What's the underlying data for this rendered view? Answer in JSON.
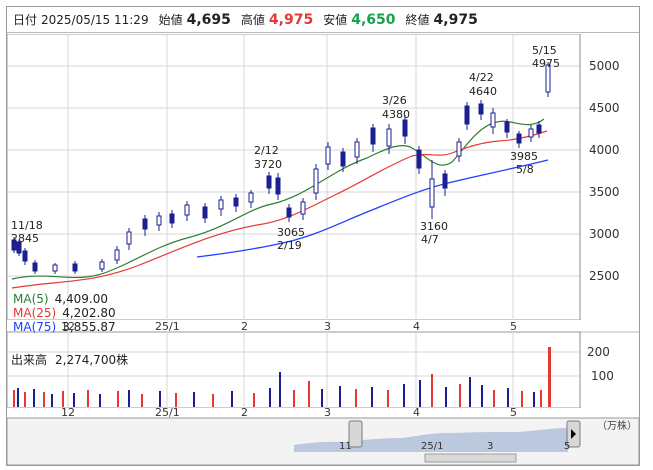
{
  "header": {
    "date_label": "日付",
    "date_value": "2025/05/15 11:29",
    "open_label": "始値",
    "open_value": "4,695",
    "high_label": "高値",
    "high_value": "4,975",
    "low_label": "安値",
    "low_value": "4,650",
    "close_label": "終値",
    "close_value": "4,975"
  },
  "price_axis": {
    "ticks": [
      "5000",
      "4500",
      "4000",
      "3500",
      "3000",
      "2500"
    ]
  },
  "time_axis": {
    "ticks": [
      "12",
      "25/1",
      "2",
      "3",
      "4",
      "5"
    ]
  },
  "annotations": [
    {
      "date": "11/18",
      "value": "2845"
    },
    {
      "date": "2/12",
      "value": "3720"
    },
    {
      "date": "2/19",
      "value": "3065"
    },
    {
      "date": "3/26",
      "value": "4380"
    },
    {
      "date": "4/7",
      "value": "3160"
    },
    {
      "date": "4/22",
      "value": "4640"
    },
    {
      "date": "5/8",
      "value": "3985"
    },
    {
      "date": "5/15",
      "value": "4975"
    }
  ],
  "ma_legend": [
    {
      "label": "MA(5)",
      "value": "4,409.00",
      "color": "#2e7d32"
    },
    {
      "label": "MA(25)",
      "value": "4,202.80",
      "color": "#e53935"
    },
    {
      "label": "MA(75)",
      "value": "3,855.87",
      "color": "#1e40ff"
    }
  ],
  "volume": {
    "label": "出来高",
    "value": "2,274,700株",
    "axis_ticks": [
      "200",
      "100"
    ],
    "unit": "（万株）"
  },
  "navigator": {
    "labels": [
      "11",
      "25/1",
      "3",
      "5"
    ]
  }
}
